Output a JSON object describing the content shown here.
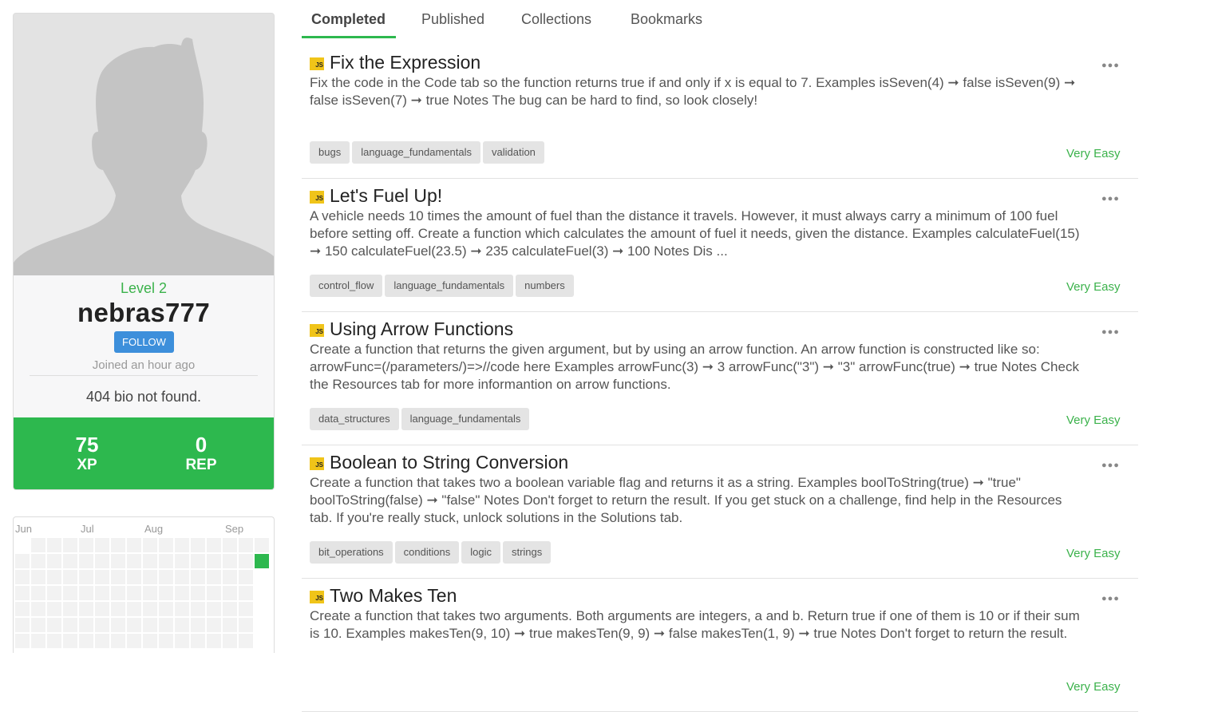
{
  "profile": {
    "level": "Level 2",
    "username": "nebras777",
    "follow_label": "FOLLOW",
    "joined": "Joined an hour ago",
    "bio": "404 bio not found.",
    "xp_value": "75",
    "xp_label": "XP",
    "rep_value": "0",
    "rep_label": "REP",
    "colors": {
      "stats_bg": "#2db84e",
      "level": "#3bb24b",
      "follow_bg": "#3d8fdb"
    }
  },
  "activity": {
    "months": [
      "Jun",
      "Jul",
      "Aug",
      "Sep"
    ],
    "active_color": "#2db84e"
  },
  "tabs": [
    {
      "label": "Completed",
      "active": true
    },
    {
      "label": "Published",
      "active": false
    },
    {
      "label": "Collections",
      "active": false
    },
    {
      "label": "Bookmarks",
      "active": false
    }
  ],
  "challenges": [
    {
      "lang_badge": "JS",
      "title": "Fix the Expression",
      "description": "Fix the code in the Code tab so the function returns true if and only if x is equal to 7. Examples isSeven(4) ➞ false isSeven(9) ➞ false isSeven(7) ➞ true Notes The bug can be hard to find, so look closely!",
      "tags": [
        "bugs",
        "language_fundamentals",
        "validation"
      ],
      "difficulty": "Very Easy"
    },
    {
      "lang_badge": "JS",
      "title": "Let's Fuel Up!",
      "description": "A vehicle needs 10 times the amount of fuel than the distance it travels. However, it must always carry a minimum of 100 fuel before setting off. Create a function which calculates the amount of fuel it needs, given the distance. Examples calculateFuel(15) ➞ 150 calculateFuel(23.5) ➞ 235 calculateFuel(3) ➞ 100 Notes Dis ...",
      "tags": [
        "control_flow",
        "language_fundamentals",
        "numbers"
      ],
      "difficulty": "Very Easy"
    },
    {
      "lang_badge": "JS",
      "title": "Using Arrow Functions",
      "description": "Create a function that returns the given argument, but by using an arrow function. An arrow function is constructed like so: arrowFunc=(/parameters/)=>//code here Examples arrowFunc(3) ➞ 3 arrowFunc(\"3\") ➞ \"3\" arrowFunc(true) ➞ true Notes Check the Resources tab for more informantion on arrow functions.",
      "tags": [
        "data_structures",
        "language_fundamentals"
      ],
      "difficulty": "Very Easy"
    },
    {
      "lang_badge": "JS",
      "title": "Boolean to String Conversion",
      "description": "Create a function that takes two a boolean variable flag and returns it as a string. Examples boolToString(true) ➞ \"true\" boolToString(false) ➞ \"false\" Notes Don't forget to return the result. If you get stuck on a challenge, find help in the Resources tab. If you're really stuck, unlock solutions in the Solutions tab.",
      "tags": [
        "bit_operations",
        "conditions",
        "logic",
        "strings"
      ],
      "difficulty": "Very Easy"
    },
    {
      "lang_badge": "JS",
      "title": "Two Makes Ten",
      "description": "Create a function that takes two arguments. Both arguments are integers, a and b. Return true if one of them is 10 or if their sum is 10. Examples makesTen(9, 10) ➞ true makesTen(9, 9) ➞ false makesTen(1, 9) ➞ true Notes Don't forget to return the result.",
      "tags": [],
      "difficulty": "Very Easy"
    }
  ]
}
